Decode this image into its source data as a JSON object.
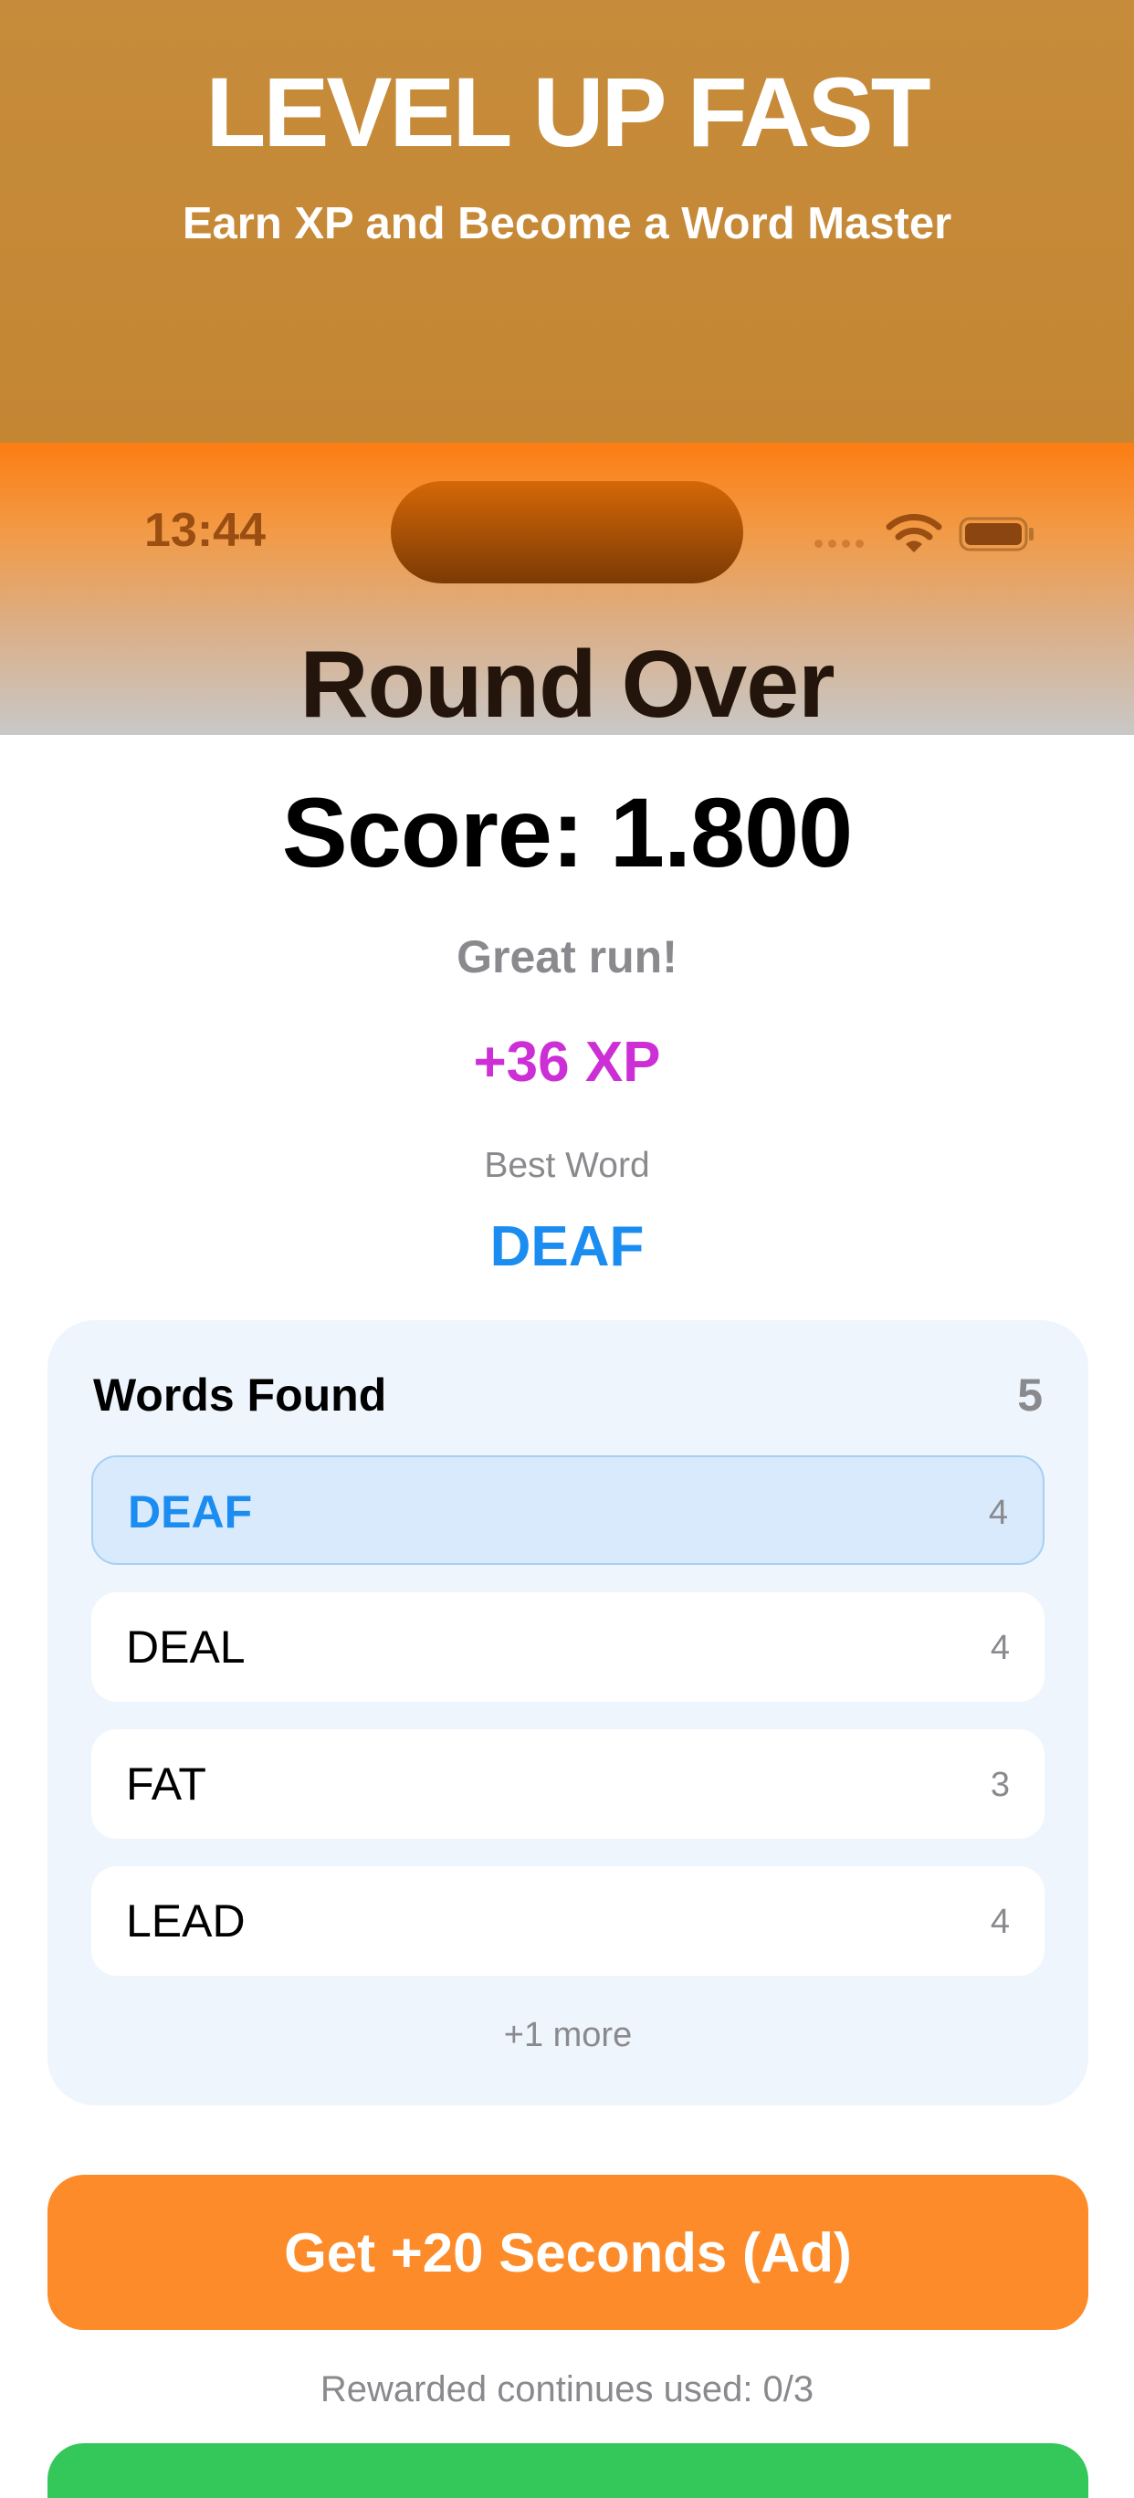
{
  "promo": {
    "title": "LEVEL UP FAST",
    "subtitle": "Earn XP and Become a Word Master"
  },
  "status_bar": {
    "time": "13:44",
    "icons": [
      "signal-dots-icon",
      "wifi-icon",
      "battery-icon"
    ]
  },
  "round": {
    "title": "Round Over",
    "score": "Score: 1.800",
    "feedback": "Great run!",
    "xp": "+36 XP",
    "best_word_label": "Best Word",
    "best_word": "DEAF"
  },
  "words_found": {
    "header": "Words Found",
    "count": "5",
    "items": [
      {
        "word": "DEAF",
        "length": "4",
        "is_best": true
      },
      {
        "word": "DEAL",
        "length": "4",
        "is_best": false
      },
      {
        "word": "FAT",
        "length": "3",
        "is_best": false
      },
      {
        "word": "LEAD",
        "length": "4",
        "is_best": false
      }
    ],
    "more": "+1 more"
  },
  "actions": {
    "ad_button_label": "Get +20 Seconds (Ad)",
    "rewarded_note": "Rewarded continues used: 0/3"
  },
  "colors": {
    "promo_bg": "#c68c3b",
    "accent_orange": "#fd8b29",
    "xp_purple": "#cd2fd6",
    "best_blue": "#1b8cf0",
    "card_bg": "#eef5fd",
    "next_green": "#34c759"
  }
}
